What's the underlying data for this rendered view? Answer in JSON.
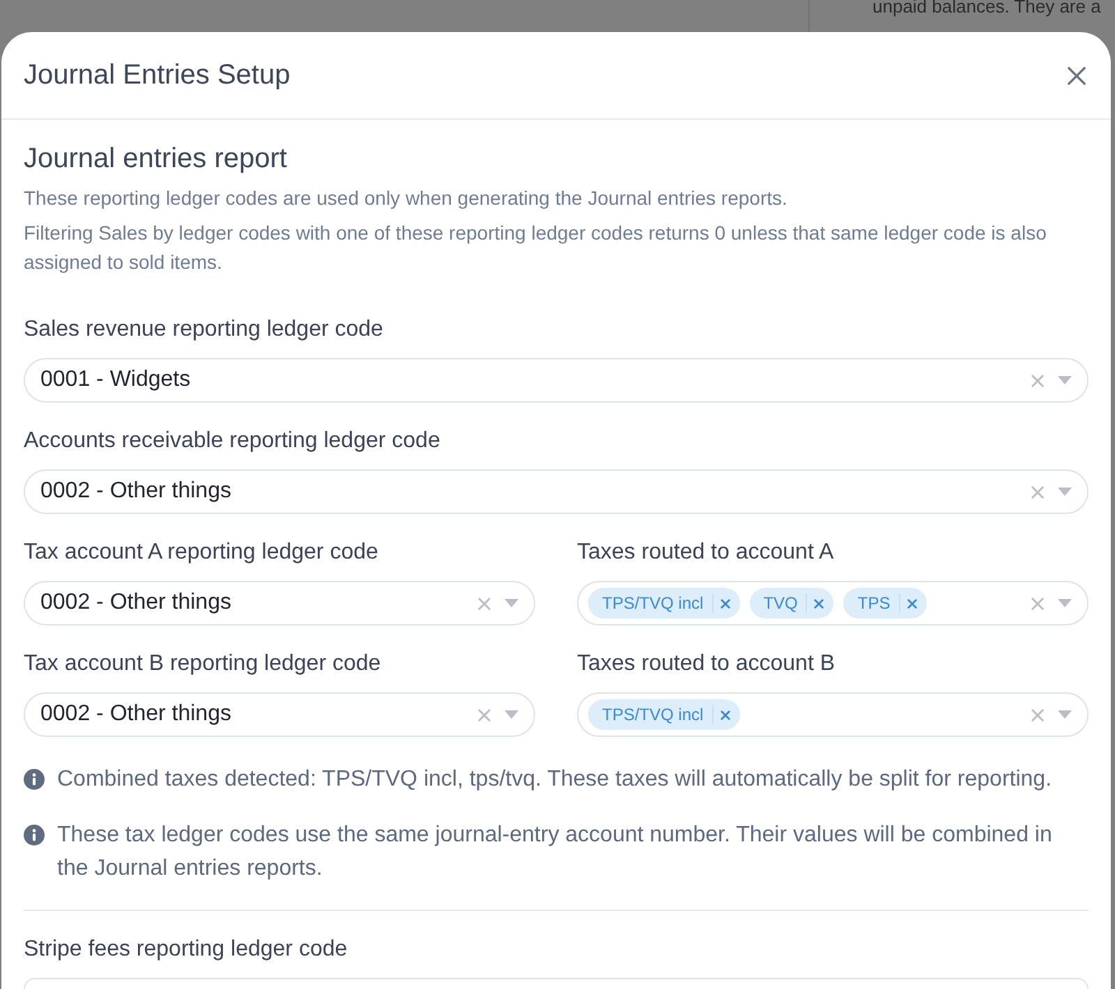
{
  "background": {
    "text": "unpaid balances. They are a"
  },
  "dialog": {
    "title": "Journal Entries Setup"
  },
  "section": {
    "heading": "Journal entries report",
    "descriptions": [
      "These reporting ledger codes are used only when generating the Journal entries reports.",
      "Filtering Sales by ledger codes with one of these reporting ledger codes returns 0 unless that same ledger code is also assigned to sold items."
    ]
  },
  "rows": [
    {
      "fields": [
        {
          "kind": "select",
          "label": "Sales revenue reporting ledger code",
          "value": "0001 - Widgets"
        }
      ]
    },
    {
      "fields": [
        {
          "kind": "select",
          "label": "Accounts receivable reporting ledger code",
          "value": "0002 - Other things"
        }
      ]
    },
    {
      "fields": [
        {
          "kind": "select",
          "label": "Tax account A reporting ledger code",
          "value": "0002 - Other things"
        },
        {
          "kind": "multiselect",
          "label": "Taxes routed to account A",
          "tags": [
            "TPS/TVQ incl",
            "TVQ",
            "TPS"
          ]
        }
      ]
    },
    {
      "fields": [
        {
          "kind": "select",
          "label": "Tax account B reporting ledger code",
          "value": "0002 - Other things"
        },
        {
          "kind": "multiselect",
          "label": "Taxes routed to account B",
          "tags": [
            "TPS/TVQ incl"
          ]
        }
      ]
    }
  ],
  "notes": [
    {
      "text": "Combined taxes detected: TPS/TVQ incl, tps/tvq. These taxes will automatically be split for reporting."
    },
    {
      "text": "These tax ledger codes use the same journal-entry account number. Their values will be combined in the Journal entries reports."
    }
  ],
  "stripe_section": {
    "label": "Stripe fees reporting ledger code"
  }
}
